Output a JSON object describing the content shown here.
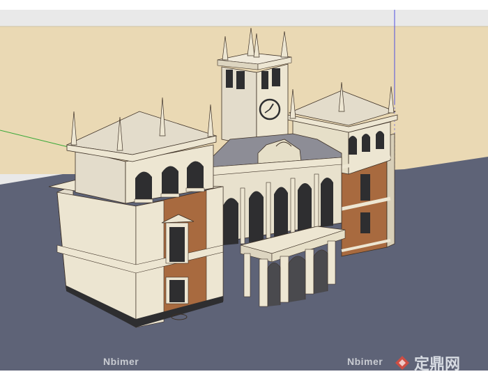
{
  "scene": {
    "sky_color": "#e9e9e9",
    "ground_color": "#5e6377",
    "plane_color": "#ead9b4",
    "stone_color": "#ede6d2",
    "brick_color": "#a86a3f",
    "roof_color": "#8d8d96",
    "window_color": "#2e2e30",
    "axis_green": "#38a838",
    "axis_blue": "#4f4fe0"
  },
  "watermarks": {
    "left": "Nbimer",
    "right": "Nbimer",
    "brand": "定鼎网",
    "brand_icon": "brand-logo-icon"
  }
}
